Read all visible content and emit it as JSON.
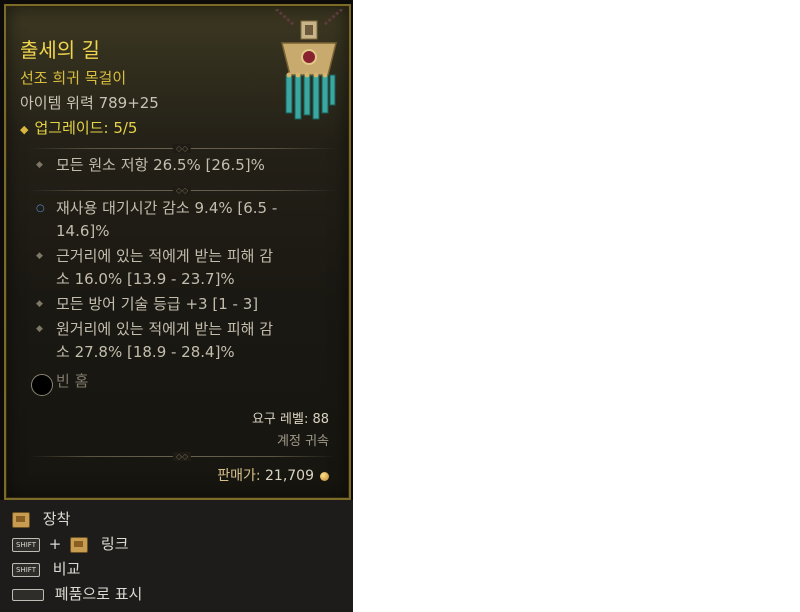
{
  "item": {
    "name": "출세의 길",
    "rarity": "선조 희귀 목걸이",
    "power_label": "아이템 위력",
    "power_value": "789+25",
    "upgrade_label": "업그레이드:",
    "upgrade_value": "5/5"
  },
  "implicit_affix": "모든 원소 저항 26.5% [26.5]%",
  "affixes": [
    {
      "line1": "재사용 대기시간 감소 9.4% [6.5 -",
      "line2": "14.6]%",
      "special": true
    },
    {
      "line1": "근거리에 있는 적에게 받는 피해 감",
      "line2": "소 16.0% [13.9 - 23.7]%",
      "special": false
    },
    {
      "line1": "모든 방어 기술 등급 +3 [1 - 3]",
      "line2": "",
      "special": false
    },
    {
      "line1": "원거리에 있는 적에게 받는 피해 감",
      "line2": "소 27.8% [18.9 - 28.4]%",
      "special": false
    }
  ],
  "socket_label": "빈 홈",
  "requirements": {
    "level": "요구 레벨: 88",
    "bound": "계정 귀속"
  },
  "sell": {
    "label": "판매가:",
    "value": "21,709"
  },
  "footer": {
    "equip": "장착",
    "shift": "SHIFT",
    "plus": "+",
    "link": "링크",
    "compare": "비교",
    "salvage": "폐품으로 표시"
  },
  "colors": {
    "name": "#f1d44d",
    "rarity": "#d9bd3f",
    "affix": "#c3bdae",
    "border": "#7c6a27"
  }
}
